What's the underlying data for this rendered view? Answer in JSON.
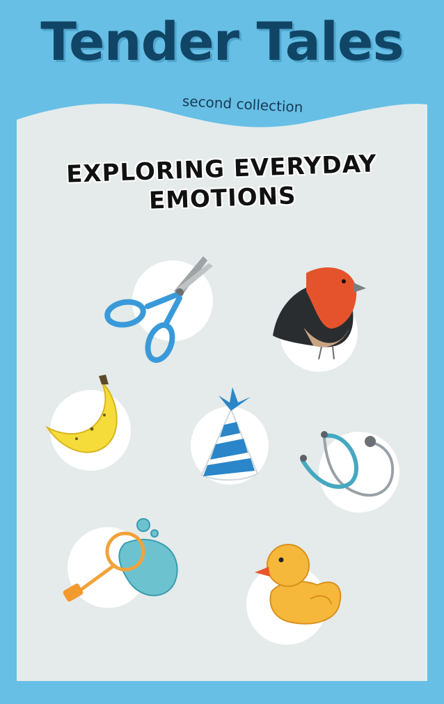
{
  "cover": {
    "title": "Tender Tales",
    "subtitle": "second collection",
    "headline_line1": "EXPLORING EVERYDAY",
    "headline_line2": "EMOTIONS"
  },
  "colors": {
    "background": "#67bfe5",
    "panel": "#e4ebea",
    "title": "#114566",
    "circle": "#ffffff"
  },
  "illustrations": [
    "scissors-icon",
    "robin-bird-icon",
    "banana-icon",
    "party-hat-icon",
    "stethoscope-icon",
    "bubble-wand-icon",
    "rubber-duck-icon"
  ]
}
